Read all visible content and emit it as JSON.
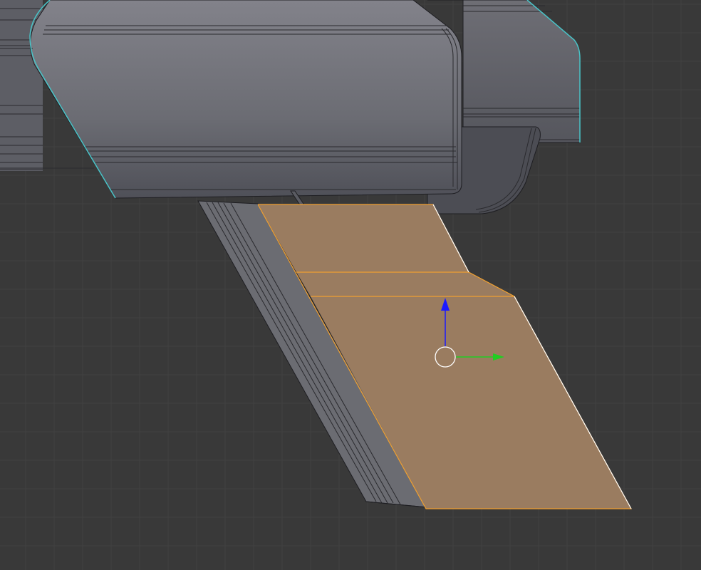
{
  "viewport": {
    "type": "3d-edit-mode",
    "background_color": "#393939",
    "grid_color": "#414141",
    "grid_major_color": "#444444"
  },
  "model": {
    "body_color_top": "#7a7a80",
    "body_color_bottom": "#4e4f56",
    "edge_color": "#1e1e22",
    "outline_color": "#49c4c8"
  },
  "selection": {
    "face_color": "#9a7c60",
    "edge_color": "#f0a030",
    "highlight_edge_color": "#ffffff"
  },
  "gizmo": {
    "z_axis_color": "#1a1aff",
    "y_axis_color": "#22cc22",
    "pivot_color": "#ffffff"
  }
}
